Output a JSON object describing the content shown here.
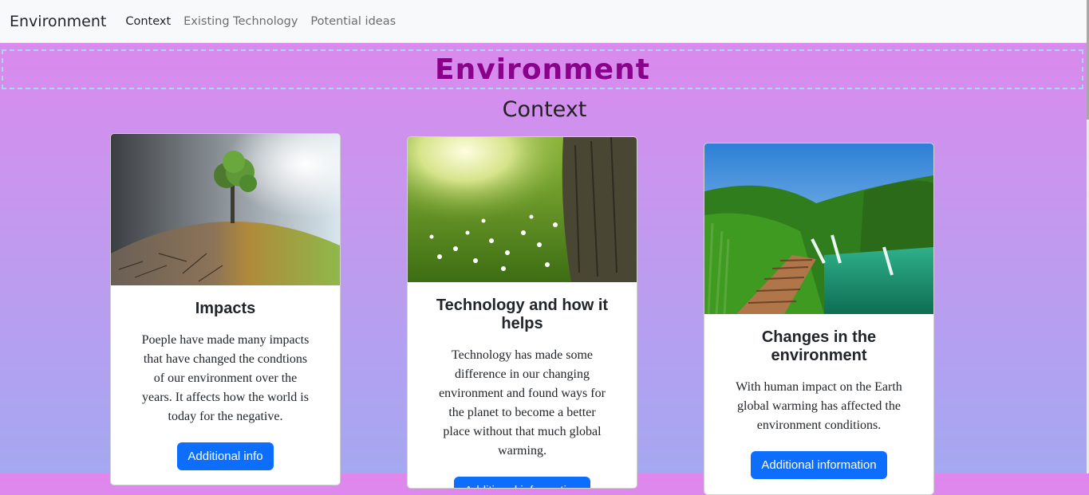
{
  "navbar": {
    "brand": "Environment",
    "links": [
      {
        "label": "Context",
        "active": true
      },
      {
        "label": "Existing Technology",
        "active": false
      },
      {
        "label": "Potential ideas",
        "active": false
      }
    ]
  },
  "hero": {
    "title": "Environment"
  },
  "section": {
    "title": "Context"
  },
  "cards": [
    {
      "image": "cracked-earth-tree-image",
      "title": "Impacts",
      "text": "Poeple have made many impacts that have changed the condtions of our environment over the years. It affects how the world is today for the negative.",
      "button": "Additional info"
    },
    {
      "image": "sunny-meadow-flowers-image",
      "title": "Technology and how it helps",
      "text": "Technology has made some difference in our changing environment and found ways for the planet to become a better place without that much global warming.",
      "button": "Additional information"
    },
    {
      "image": "waterfall-boardwalk-image",
      "title": "Changes in the environment",
      "text": "With human impact on the Earth global warming has affected the environment conditions.",
      "button": "Additional information"
    }
  ],
  "colors": {
    "accent": "#0d6efd",
    "hero_title": "#8b008b",
    "background_top": "#e086ec",
    "background_bottom": "#a5a8f0"
  }
}
